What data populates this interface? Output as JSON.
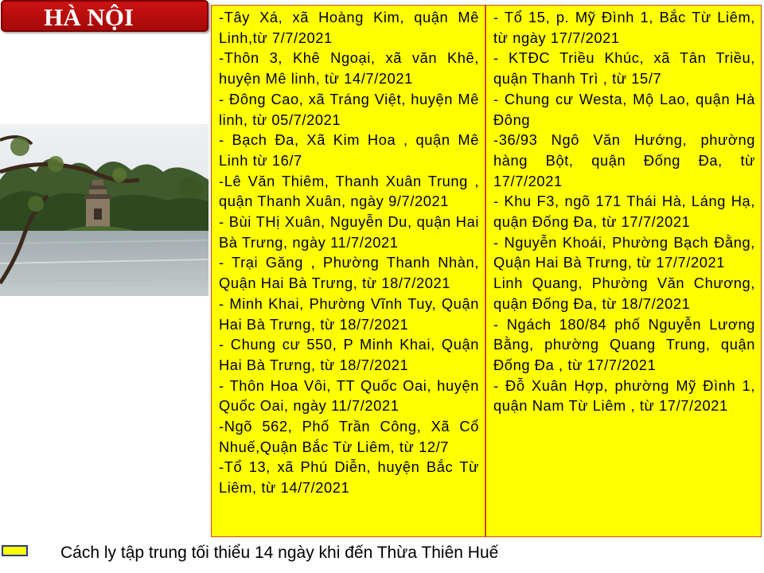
{
  "title": "HÀ NỘI",
  "photo_icon": "hoan-kiem-lake-turtle-tower-photo",
  "column1": [
    "-Tây Xá, xã Hoàng Kim, quận Mê Linh,từ 7/7/2021",
    "-Thôn 3, Khê Ngoại, xã văn Khê, huyện Mê linh, từ 14/7/2021",
    "- Đông Cao, xã Tráng Việt, huyện Mê linh, từ 05/7/2021",
    "- Bạch Đa, Xã Kim Hoa , quận Mê Linh từ 16/7",
    "-Lê Văn Thiêm, Thanh Xuân Trung , quận Thanh Xuân, ngày 9/7/2021",
    "- Bùi THị Xuân, Nguyễn Du, quận Hai Bà Trưng, ngày 11/7/2021",
    "- Trại Găng , Phường Thanh Nhàn, Quận Hai Bà Trưng, từ 18/7/2021",
    "- Minh Khai, Phường Vĩnh Tuy, Quận Hai Bà Trưng, từ 18/7/2021",
    "- Chung cư 550, P Minh Khai, Quận Hai Bà Trưng, từ 18/7/2021",
    "- Thôn Hoa Vôi, TT Quốc Oai, huyện Quốc Oai, ngày 11/7/2021",
    "-Ngõ 562, Phố Trần Công, Xã Cổ Nhuế,Quận Bắc Từ Liêm, từ 12/7",
    "-Tổ 13, xã Phú Diễn, huyện Bắc Từ Liêm, từ 14/7/2021"
  ],
  "column2": [
    "- Tổ 15, p. Mỹ Đình 1, Bắc Từ Liêm, từ ngày 17/7/2021",
    "- KTĐC Triều Khúc, xã Tân Triều, quận Thanh Trì , từ 15/7",
    "- Chung cư Westa, Mộ Lao, quận Hà Đông",
    "-36/93 Ngô Văn Hướng, phường hàng Bột, quận Đống Đa, từ 17/7/2021",
    "- Khu F3, ngõ 171 Thái Hà, Láng Hạ, quận Đống Đa, từ 17/7/2021",
    "- Nguyễn Khoái, Phường Bạch Đằng, Quận Hai Bà Trưng, từ 17/7/2021",
    "Linh Quang, Phường Văn Chương, quận Đống Đa, từ 18/7/2021",
    "- Ngách 180/84 phố Nguyễn Lương Bằng, phường Quang Trung, quận Đống Đa , từ 17/7/2021",
    "- Đỗ Xuân Hợp, phường Mỹ Đình 1, quận Nam Từ Liêm , từ 17/7/2021"
  ],
  "legend": {
    "color": "#ffff00",
    "text": "Cách ly tập trung tối thiểu 14 ngày khi đến Thừa Thiên Huế"
  }
}
